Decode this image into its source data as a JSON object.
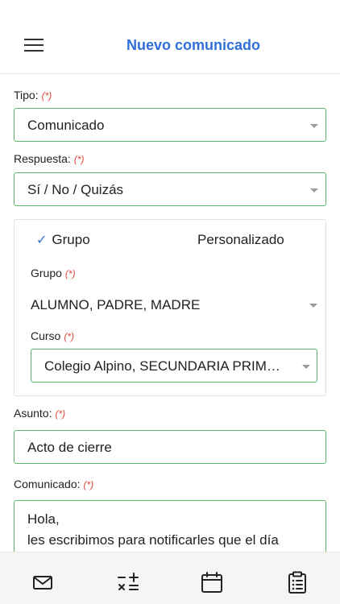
{
  "header": {
    "title": "Nuevo comunicado",
    "menu_icon": "hamburger-menu-icon"
  },
  "form": {
    "required_mark": "(*)",
    "tipo": {
      "label": "Tipo:",
      "value": "Comunicado"
    },
    "respuesta": {
      "label": "Respuesta:",
      "value": "Sí / No / Quizás"
    },
    "recipients": {
      "tabs": [
        {
          "label": "Grupo",
          "selected": true
        },
        {
          "label": "Personalizado",
          "selected": false
        }
      ],
      "grupo": {
        "label": "Grupo",
        "value": "ALUMNO, PADRE, MADRE"
      },
      "curso": {
        "label": "Curso",
        "value": "Colegio Alpino, SECUNDARIA PRIMERO A"
      }
    },
    "asunto": {
      "label": "Asunto:",
      "value": "Acto de cierre"
    },
    "comunicado": {
      "label": "Comunicado:",
      "value": "Hola,\nles escribimos para notificarles que el día"
    }
  },
  "bottom_nav": {
    "items": [
      {
        "icon": "mail-icon"
      },
      {
        "icon": "calculator-icon"
      },
      {
        "icon": "calendar-icon"
      },
      {
        "icon": "clipboard-list-icon"
      }
    ]
  },
  "colors": {
    "accent": "#2f6fd6",
    "field_border": "#5ab76c",
    "required": "#e0463a"
  }
}
